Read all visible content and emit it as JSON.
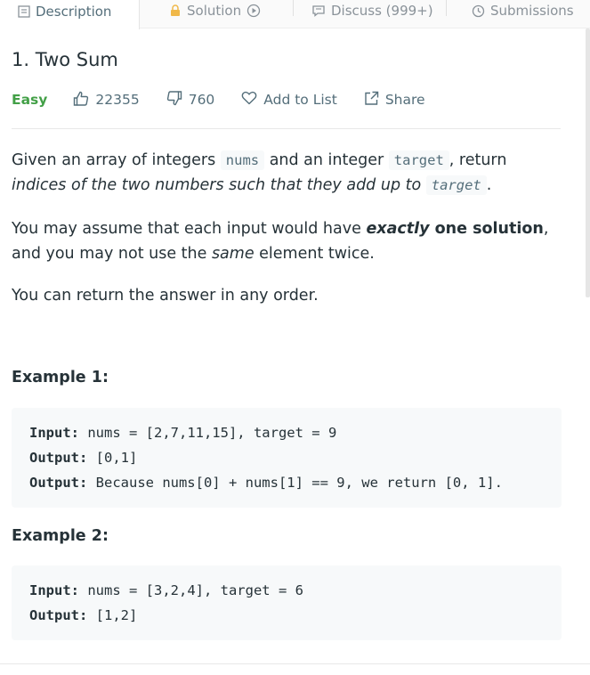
{
  "tabs": [
    {
      "label": "Description",
      "icon": "description-icon"
    },
    {
      "label": "Solution",
      "icon": "lock-icon"
    },
    {
      "label": "Discuss (999+)",
      "icon": "discuss-icon"
    },
    {
      "label": "Submissions",
      "icon": "clock-icon"
    }
  ],
  "problem": {
    "title": "1. Two Sum",
    "difficulty": "Easy",
    "likes": "22355",
    "dislikes": "760",
    "add_to_list": "Add to List",
    "share": "Share"
  },
  "description": {
    "p1": {
      "a": "Given an array of integers ",
      "code1": "nums",
      "b": " and an integer ",
      "code2": "target",
      "c": ", return ",
      "em": "indices of the two numbers such that they add up to",
      "d": " ",
      "code3": "target",
      "e": "."
    },
    "p2": {
      "a": "You may assume that each input would have ",
      "em_strong": "exactly",
      "strong": " one solution",
      "b": ", and you may not use the ",
      "em": "same",
      "c": " element twice."
    },
    "p3": "You can return the answer in any order."
  },
  "examples": [
    {
      "title": "Example 1:",
      "lines": [
        {
          "key": "Input:",
          "value": " nums = [2,7,11,15], target = 9"
        },
        {
          "key": "Output:",
          "value": " [0,1]"
        },
        {
          "key": "Output:",
          "value": " Because nums[0] + nums[1] == 9, we return [0, 1]."
        }
      ]
    },
    {
      "title": "Example 2:",
      "lines": [
        {
          "key": "Input:",
          "value": " nums = [3,2,4], target = 6"
        },
        {
          "key": "Output:",
          "value": " [1,2]"
        }
      ]
    }
  ],
  "colors": {
    "easy": "#43a047",
    "text": "#263238",
    "muted": "#546e7a",
    "code_bg": "#f7f9fa"
  }
}
